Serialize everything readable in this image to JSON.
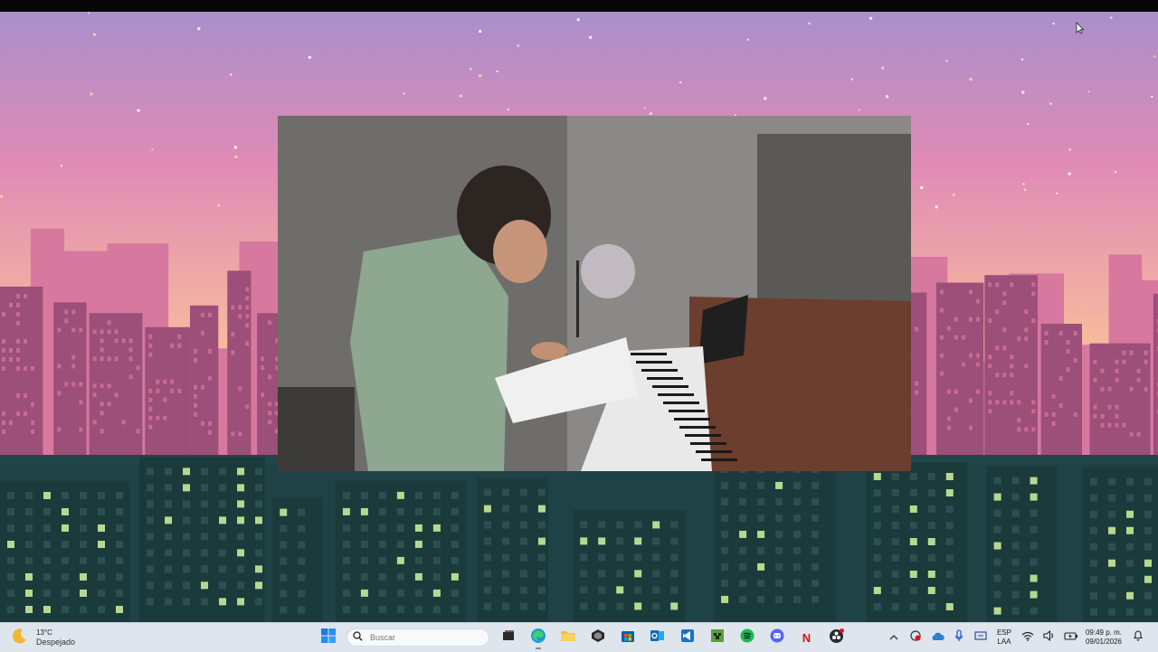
{
  "desktop": {
    "wallpaper": "pixel-art city skyline at dusk",
    "colors": {
      "sky_top": "#a98fcb",
      "sky_mid": "#e08bb6",
      "sky_low": "#f7bb9c",
      "city_far": "#d7789f",
      "city_mid": "#9c4f78",
      "city_near": "#1b3a3b",
      "window_light": "#b7d98f"
    }
  },
  "video_window": {
    "content": "video frame"
  },
  "taskbar": {
    "weather": {
      "icon": "moon-icon",
      "temperature": "13°C",
      "condition": "Despejado"
    },
    "start_icon": "windows-start-icon",
    "search": {
      "placeholder": "Buscar",
      "value": ""
    },
    "pinned_apps": [
      {
        "name": "Task View",
        "icon": "task-view-icon"
      },
      {
        "name": "Microsoft Edge",
        "icon": "edge-icon"
      },
      {
        "name": "File Explorer",
        "icon": "folder-icon"
      },
      {
        "name": "Unity",
        "icon": "unity-icon"
      },
      {
        "name": "Microsoft Store",
        "icon": "store-icon"
      },
      {
        "name": "Outlook",
        "icon": "outlook-icon"
      },
      {
        "name": "Visual Studio Code",
        "icon": "vscode-icon"
      },
      {
        "name": "Minecraft",
        "icon": "minecraft-icon"
      },
      {
        "name": "Spotify",
        "icon": "spotify-icon"
      },
      {
        "name": "Discord",
        "icon": "discord-icon"
      },
      {
        "name": "Netflix",
        "icon": "netflix-icon",
        "label": "N"
      },
      {
        "name": "OBS Studio",
        "icon": "obs-icon"
      }
    ],
    "tray": {
      "chevron": "chevron-up-icon",
      "language": {
        "line1": "ESP",
        "line2": "LAA"
      },
      "clock": {
        "time": "09:49 p. m.",
        "date": "09/01/2026"
      }
    }
  }
}
